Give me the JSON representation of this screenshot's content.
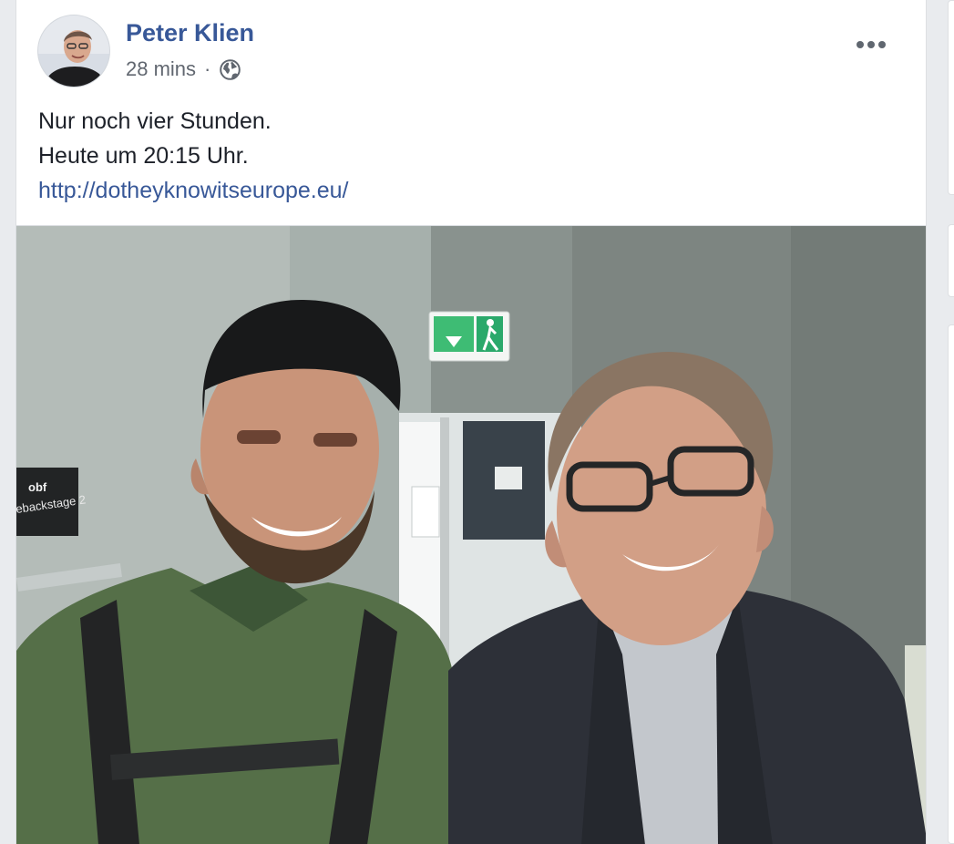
{
  "post": {
    "author": "Peter Klien",
    "time": "28 mins",
    "separator": "·",
    "privacy_icon": "globe-icon",
    "more_icon": "more-options-icon",
    "message_lines": [
      "Nur noch vier Stunden.",
      "Heute um 20:15 Uhr."
    ],
    "link": "http://dotheyknowitseurope.eu/"
  },
  "photo": {
    "sign_text": "ebackstage 2",
    "sign_logo": "obf",
    "exit_sign_icon": "emergency-exit-icon"
  },
  "colors": {
    "page_background": "#e9ebee",
    "card_background": "#ffffff",
    "author_blue": "#385898",
    "text": "#1d2129",
    "meta_text": "#616770"
  }
}
